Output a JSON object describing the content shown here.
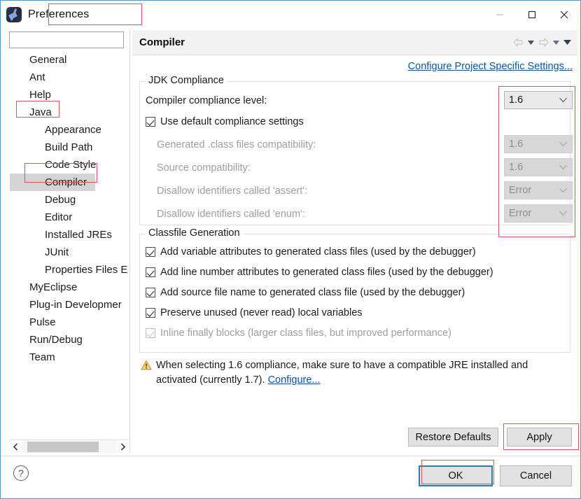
{
  "window": {
    "title": "Preferences",
    "app_icon": "eclipse-icon",
    "minimize_icon": "minimize-icon",
    "maximize_icon": "maximize-icon",
    "close_icon": "close-icon"
  },
  "sidebar": {
    "filter_placeholder": "",
    "filter_value": "",
    "items": [
      {
        "label": "General",
        "level": 0,
        "selected": false
      },
      {
        "label": "Ant",
        "level": 0,
        "selected": false
      },
      {
        "label": "Help",
        "level": 0,
        "selected": false
      },
      {
        "label": "Java",
        "level": 0,
        "selected": false
      },
      {
        "label": "Appearance",
        "level": 1,
        "selected": false
      },
      {
        "label": "Build Path",
        "level": 1,
        "selected": false
      },
      {
        "label": "Code Style",
        "level": 1,
        "selected": false
      },
      {
        "label": "Compiler",
        "level": 1,
        "selected": true
      },
      {
        "label": "Debug",
        "level": 1,
        "selected": false
      },
      {
        "label": "Editor",
        "level": 1,
        "selected": false
      },
      {
        "label": "Installed JREs",
        "level": 1,
        "selected": false
      },
      {
        "label": "JUnit",
        "level": 1,
        "selected": false
      },
      {
        "label": "Properties Files E",
        "level": 1,
        "selected": false
      },
      {
        "label": "MyEclipse",
        "level": 0,
        "selected": false
      },
      {
        "label": "Plug-in Developmer",
        "level": 0,
        "selected": false
      },
      {
        "label": "Pulse",
        "level": 0,
        "selected": false
      },
      {
        "label": "Run/Debug",
        "level": 0,
        "selected": false
      },
      {
        "label": "Team",
        "level": 0,
        "selected": false
      }
    ],
    "scroll_left_icon": "chevron-left-icon",
    "scroll_right_icon": "chevron-right-icon"
  },
  "content": {
    "title": "Compiler",
    "toolbar": {
      "back_icon": "back-arrow-icon",
      "back_caret": "chevron-down-icon",
      "forward_icon": "forward-arrow-icon",
      "forward_caret": "chevron-down-icon",
      "menu_caret": "chevron-down-icon"
    },
    "project_settings_link": "Configure Project Specific Settings...",
    "jdk_group": {
      "title": "JDK Compliance",
      "compliance_label": "Compiler compliance level:",
      "compliance_value": "1.6",
      "use_default_label": "Use default compliance settings",
      "use_default_checked": true,
      "rows": [
        {
          "label": "Generated .class files compatibility:",
          "value": "1.6",
          "enabled": false
        },
        {
          "label": "Source compatibility:",
          "value": "1.6",
          "enabled": false
        },
        {
          "label": "Disallow identifiers called 'assert':",
          "value": "Error",
          "enabled": false
        },
        {
          "label": "Disallow identifiers called 'enum':",
          "value": "Error",
          "enabled": false
        }
      ]
    },
    "classfile_group": {
      "title": "Classfile Generation",
      "options": [
        {
          "label": "Add variable attributes to generated class files (used by the debugger)",
          "checked": true,
          "enabled": true
        },
        {
          "label": "Add line number attributes to generated class files (used by the debugger)",
          "checked": true,
          "enabled": true
        },
        {
          "label": "Add source file name to generated class file (used by the debugger)",
          "checked": true,
          "enabled": true
        },
        {
          "label": "Preserve unused (never read) local variables",
          "checked": true,
          "enabled": true
        },
        {
          "label": "Inline finally blocks (larger class files, but improved performance)",
          "checked": true,
          "enabled": false
        }
      ]
    },
    "warning": {
      "icon": "warning-triangle-icon",
      "text": "When selecting 1.6 compliance, make sure to have a compatible JRE installed and activated (currently 1.7). ",
      "link": "Configure..."
    }
  },
  "buttons": {
    "restore_defaults": "Restore Defaults",
    "apply": "Apply",
    "ok": "OK",
    "cancel": "Cancel",
    "help_icon": "help-question-icon"
  },
  "colors": {
    "link": "#0b54a4",
    "annotation": "#e0535c",
    "focus_border": "#2d7cb8",
    "selection": "#d4d4d4",
    "warning": "#e8a33d"
  }
}
